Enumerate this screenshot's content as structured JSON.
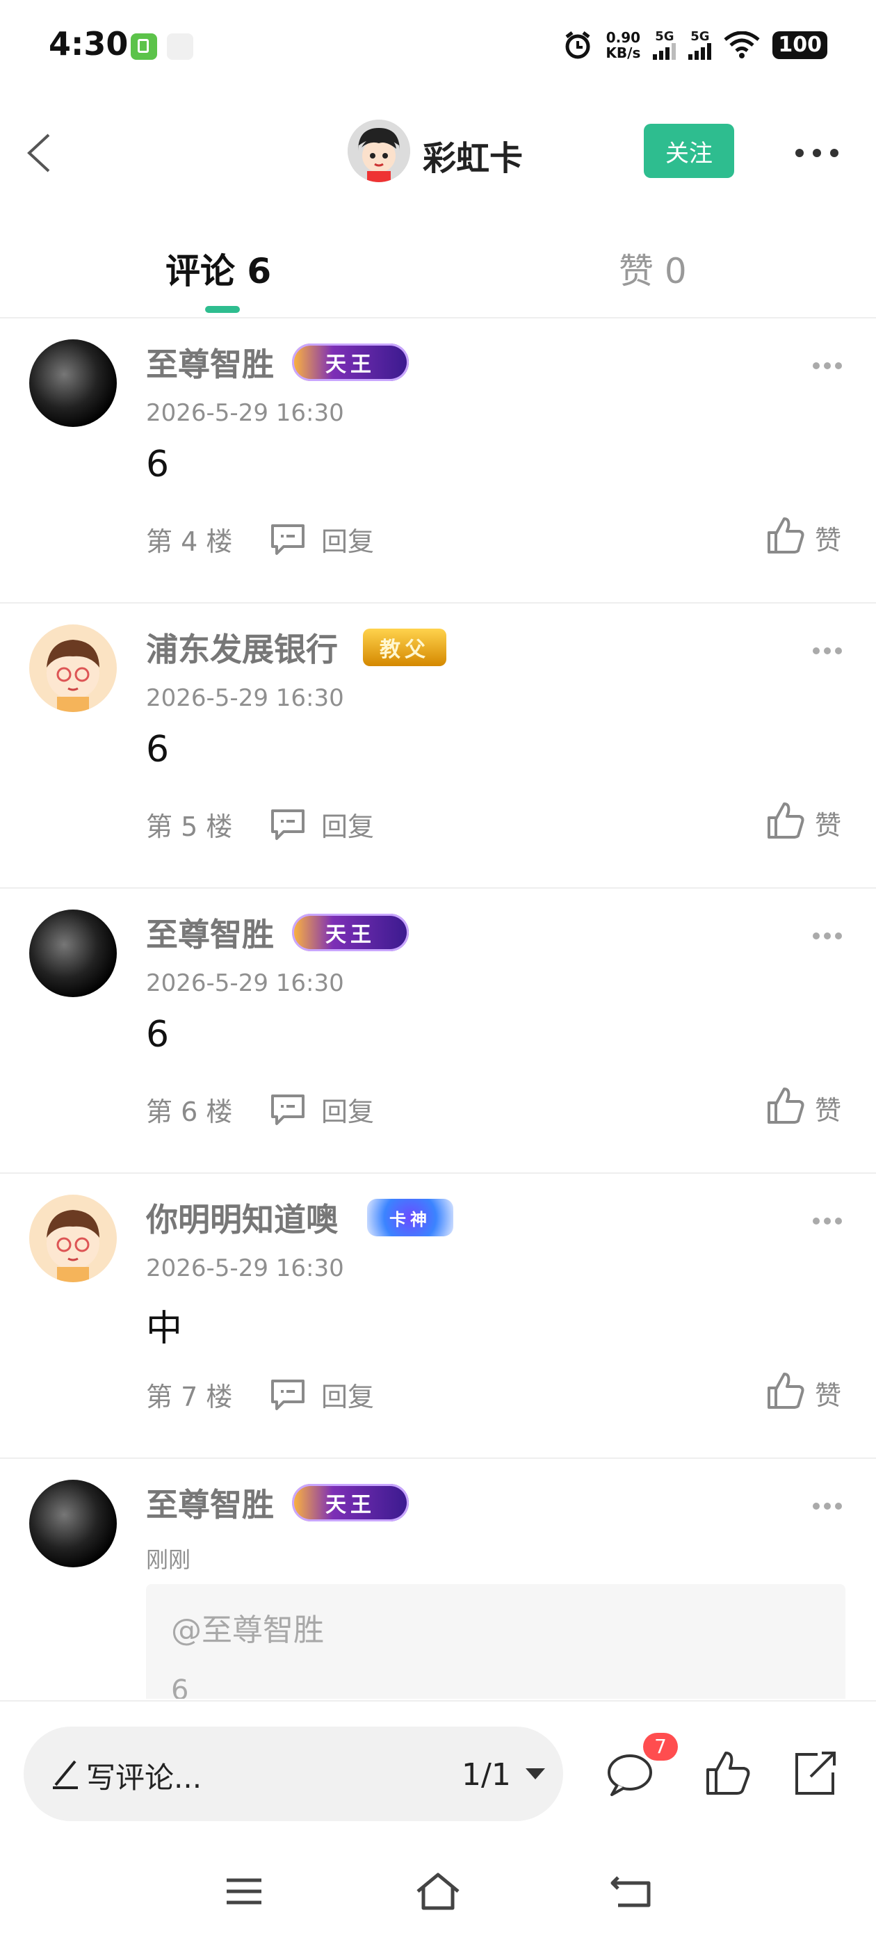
{
  "status_bar": {
    "time": "4:30",
    "net_speed": "0.90",
    "net_speed_unit": "KB/s",
    "signal1_label": "5G",
    "signal2_label": "5G",
    "battery": "100"
  },
  "header": {
    "title": "彩虹卡",
    "follow_label": "关注"
  },
  "tabs": {
    "comments": "评论 6",
    "likes": "赞 0"
  },
  "comments": [
    {
      "user": "至尊智胜",
      "badge": "天王",
      "time": "2026-5-29 16:30",
      "text": "6",
      "floor": "第 4 楼",
      "reply": "回复",
      "like": "赞"
    },
    {
      "user": "浦东发展银行",
      "badge": "教父",
      "time": "2026-5-29 16:30",
      "text": "6",
      "floor": "第 5 楼",
      "reply": "回复",
      "like": "赞"
    },
    {
      "user": "至尊智胜",
      "badge": "天王",
      "time": "2026-5-29 16:30",
      "text": "6",
      "floor": "第 6 楼",
      "reply": "回复",
      "like": "赞"
    },
    {
      "user": "你明明知道噢",
      "badge": "卡神",
      "time": "2026-5-29 16:30",
      "text": "中",
      "floor": "第 7 楼",
      "reply": "回复",
      "like": "赞"
    },
    {
      "user": "至尊智胜",
      "badge": "天王",
      "time": "刚刚",
      "quote_user": "@至尊智胜",
      "quote_text": "6"
    }
  ],
  "bottom_bar": {
    "input_placeholder": "写评论...",
    "page_indicator": "1/1",
    "comment_count": "7"
  }
}
